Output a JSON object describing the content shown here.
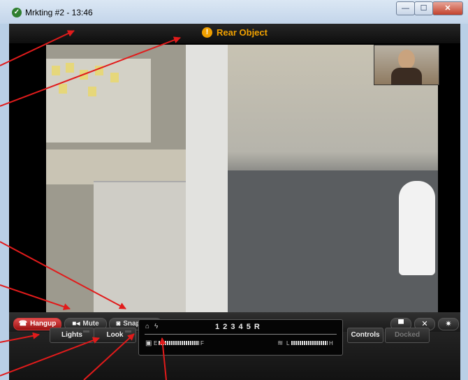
{
  "window": {
    "title": "Mrkting #2 - 13:46"
  },
  "status": {
    "alert_text": "Rear Object"
  },
  "toolbar": {
    "hangup": "Hangup",
    "mute": "Mute",
    "snapshot": "Snapshot"
  },
  "panel": {
    "lights": "Lights",
    "look": "Look",
    "gears": "1 2 3 4 5 R",
    "battery_low": "E",
    "battery_high": "F",
    "wifi_low": "L",
    "wifi_high": "H",
    "controls": "Controls",
    "docked": "Docked"
  },
  "colors": {
    "alert": "#f0a000",
    "hangup": "#c62020",
    "annotation_arrow": "#e11b1b"
  },
  "icons": [
    "app-icon",
    "alert-icon",
    "phone-icon",
    "camera-icon",
    "snapshot-icon",
    "chat-icon",
    "fullscreen-icon",
    "gear-icon",
    "home-icon",
    "bolt-icon",
    "battery-icon",
    "wifi-icon"
  ]
}
